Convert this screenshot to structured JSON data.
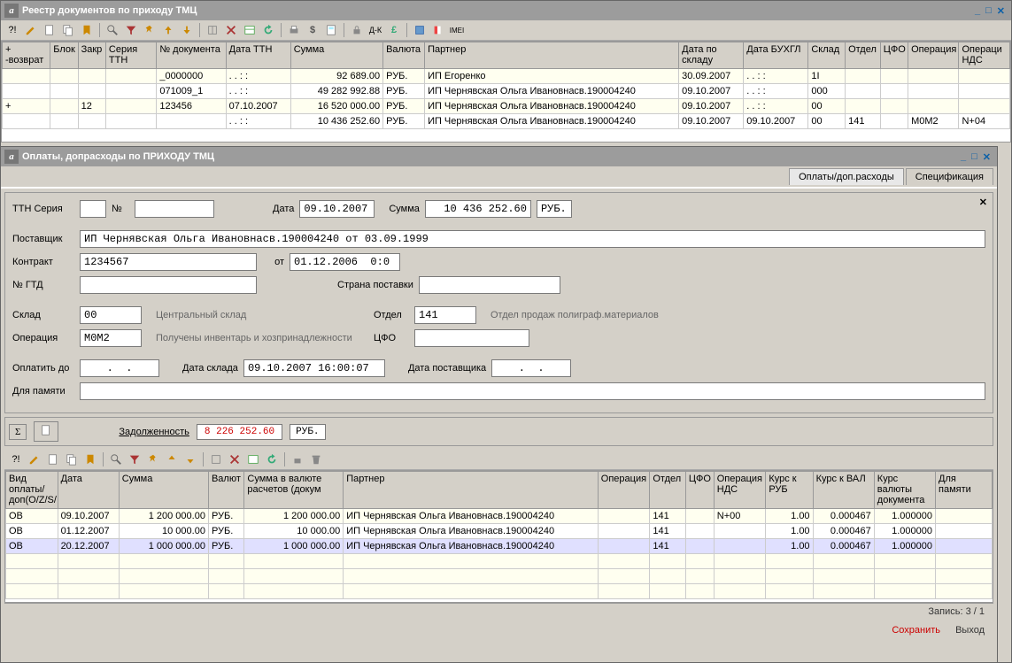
{
  "main_window": {
    "title": "Реестр документов по приходу ТМЦ",
    "columns": [
      "+ -возврат",
      "Блок",
      "Закр",
      "Серия ТТН",
      "№ документа",
      "Дата ТТН",
      "Сумма",
      "Валюта",
      "Партнер",
      "Дата по складу",
      "Дата БУХГЛ",
      "Склад",
      "Отдел",
      "ЦФО",
      "Операция",
      "Операци НДС"
    ],
    "rows": [
      {
        "ret": "",
        "blok": "",
        "zakr": "",
        "ser": "",
        "num": "_0000000",
        "date": ". .    :  :",
        "sum": "92 689.00",
        "val": "РУБ.",
        "partner": "ИП Егоренко",
        "dsklad": "30.09.2007",
        "dbuh": ". .    :  :",
        "sklad": "1I",
        "otdel": "",
        "cfo": "",
        "op": "",
        "opnds": ""
      },
      {
        "ret": "",
        "blok": "",
        "zakr": "",
        "ser": "",
        "num": "071009_1",
        "date": ". .    :  :",
        "sum": "49 282 992.88",
        "val": "РУБ.",
        "partner": "ИП Чернявская Ольга Ивановнасв.190004240",
        "dsklad": "09.10.2007",
        "dbuh": ". .    :  :",
        "sklad": "000",
        "otdel": "",
        "cfo": "",
        "op": "",
        "opnds": ""
      },
      {
        "ret": "+",
        "blok": "",
        "zakr": "12",
        "ser": "",
        "num": "123456",
        "date": "07.10.2007",
        "sum": "16 520 000.00",
        "val": "РУБ.",
        "partner": "ИП Чернявская Ольга Ивановнасв.190004240",
        "dsklad": "09.10.2007",
        "dbuh": ". .    :  :",
        "sklad": "00",
        "otdel": "",
        "cfo": "",
        "op": "",
        "opnds": ""
      },
      {
        "ret": "",
        "blok": "",
        "zakr": "",
        "ser": "",
        "num": "",
        "date": ". .    :  :",
        "sum": "10 436 252.60",
        "val": "РУБ.",
        "partner": "ИП Чернявская Ольга Ивановнасв.190004240",
        "dsklad": "09.10.2007",
        "dbuh": "09.10.2007",
        "sklad": "00",
        "otdel": "141",
        "cfo": "",
        "op": "M0M2",
        "opnds": "N+04"
      }
    ]
  },
  "sub_window": {
    "title": "Оплаты, допрасходы по ПРИХОДУ ТМЦ",
    "tabs": {
      "t1": "Оплаты/доп.расходы",
      "t2": "Спецификация"
    },
    "form": {
      "ttn_seria_lbl": "ТТН Серия",
      "num_lbl": "№",
      "num_val": "",
      "date_lbl": "Дата",
      "date_val": "09.10.2007",
      "sum_lbl": "Сумма",
      "sum_val": "10 436 252.60",
      "sum_cur": "РУБ.",
      "supplier_lbl": "Поставщик",
      "supplier_val": "ИП Чернявская Ольга Ивановнасв.190004240 от 03.09.1999",
      "contract_lbl": "Контракт",
      "contract_val": "1234567",
      "ot_lbl": "от",
      "ot_val": "01.12.2006  0:0",
      "gtd_lbl": "№ ГТД",
      "gtd_val": "",
      "country_lbl": "Страна поставки",
      "country_val": "",
      "sklad_lbl": "Склад",
      "sklad_val": "00",
      "sklad_desc": "Центральный склад",
      "otdel_lbl": "Отдел",
      "otdel_val": "141",
      "otdel_desc": "Отдел продаж полиграф.материалов",
      "op_lbl": "Операция",
      "op_val": "M0M2",
      "op_desc": "Получены инвентарь и хозпринадлежности",
      "cfo_lbl": "ЦФО",
      "cfo_val": "",
      "payto_lbl": "Оплатить до",
      "payto_val": ".  .",
      "dsklad_lbl": "Дата склада",
      "dsklad_val": "09.10.2007 16:00:07",
      "dsup_lbl": "Дата поставщика",
      "dsup_val": ".  .",
      "memo_lbl": "Для памяти",
      "memo_val": ""
    },
    "debt_lbl": "Задолженность",
    "debt_val": "8 226 252.60",
    "debt_cur": "РУБ.",
    "pay_columns": [
      "Вид оплаты/доп(O/Z/S/",
      "Дата",
      "Сумма",
      "Валют",
      "Сумма в валюте расчетов (докум",
      "Партнер",
      "Операция",
      "Отдел",
      "ЦФО",
      "Операция НДС",
      "Курс к РУБ",
      "Курс к ВАЛ",
      "Курс валюты документа",
      "Для памяти"
    ],
    "pay_rows": [
      {
        "vid": "ОВ",
        "date": "09.10.2007",
        "sum": "1 200 000.00",
        "val": "РУБ.",
        "sumv": "1 200 000.00",
        "partner": "ИП Чернявская Ольга Ивановнасв.190004240",
        "op": "",
        "otdel": "141",
        "cfo": "",
        "opnds": "N+00",
        "kr": "1.00",
        "kv": "0.000467",
        "kd": "1.000000",
        "memo": ""
      },
      {
        "vid": "ОВ",
        "date": "01.12.2007",
        "sum": "10 000.00",
        "val": "РУБ.",
        "sumv": "10 000.00",
        "partner": "ИП Чернявская Ольга Ивановнасв.190004240",
        "op": "",
        "otdel": "141",
        "cfo": "",
        "opnds": "",
        "kr": "1.00",
        "kv": "0.000467",
        "kd": "1.000000",
        "memo": ""
      },
      {
        "vid": "ОВ",
        "date": "20.12.2007",
        "sum": "1 000 000.00",
        "val": "РУБ.",
        "sumv": "1 000 000.00",
        "partner": "ИП Чернявская Ольга Ивановнасв.190004240",
        "op": "",
        "otdel": "141",
        "cfo": "",
        "opnds": "",
        "kr": "1.00",
        "kv": "0.000467",
        "kd": "1.000000",
        "memo": ""
      }
    ],
    "record_status": "Запись: 3 / 1",
    "btn_save": "Сохранить",
    "btn_exit": "Выход"
  }
}
